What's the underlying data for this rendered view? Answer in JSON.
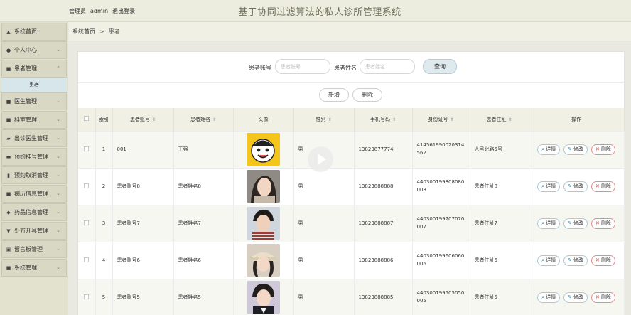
{
  "header": {
    "role": "管理员",
    "username": "admin",
    "logout": "退出登录",
    "title": "基于协同过滤算法的私人诊所管理系统"
  },
  "sidebar": {
    "items": [
      {
        "label": "系统首页",
        "icon": "home-icon",
        "glyph": "▲"
      },
      {
        "label": "个人中心",
        "icon": "user-icon",
        "glyph": "●",
        "chevron": "⌄"
      },
      {
        "label": "患者管理",
        "icon": "grid-icon",
        "glyph": "■",
        "chevron": "⌃"
      },
      {
        "label": "医生管理",
        "icon": "grid-icon",
        "glyph": "■",
        "chevron": "⌄"
      },
      {
        "label": "科室管理",
        "icon": "grid-icon",
        "glyph": "■",
        "chevron": "⌄"
      },
      {
        "label": "出诊医生管理",
        "icon": "briefcase-icon",
        "glyph": "▰",
        "chevron": "⌄"
      },
      {
        "label": "预约挂号管理",
        "icon": "monitor-icon",
        "glyph": "▬",
        "chevron": "⌄"
      },
      {
        "label": "预约取消管理",
        "icon": "chart-icon",
        "glyph": "▮",
        "chevron": "⌄"
      },
      {
        "label": "病历信息管理",
        "icon": "grid-icon",
        "glyph": "■",
        "chevron": "⌄"
      },
      {
        "label": "药品信息管理",
        "icon": "pill-icon",
        "glyph": "◆",
        "chevron": "⌄"
      },
      {
        "label": "处方开具管理",
        "icon": "shield-icon",
        "glyph": "▼",
        "chevron": "⌄"
      },
      {
        "label": "留言板管理",
        "icon": "message-icon",
        "glyph": "▣",
        "chevron": "⌄"
      },
      {
        "label": "系统管理",
        "icon": "grid-icon",
        "glyph": "■",
        "chevron": "⌄"
      }
    ],
    "sub_item": "患者"
  },
  "breadcrumb": {
    "home": "系统首页",
    "separator": ">",
    "current": "患者"
  },
  "search": {
    "account_label": "患者账号",
    "account_placeholder": "患者账号",
    "name_label": "患者姓名",
    "name_placeholder": "患者姓名",
    "query_button": "查询"
  },
  "actions": {
    "add": "新增",
    "delete": "删除"
  },
  "table": {
    "headers": [
      "索引",
      "患者账号",
      "患者姓名",
      "头像",
      "性别",
      "手机号码",
      "身份证号",
      "患者住址",
      "操作"
    ],
    "rows": [
      {
        "index": "1",
        "account": "001",
        "name": "王强",
        "gender": "男",
        "phone": "13823877774",
        "idcard": "414561990020314562",
        "address": "人民北路5号"
      },
      {
        "index": "2",
        "account": "患者账号8",
        "name": "患者姓名8",
        "gender": "男",
        "phone": "13823888888",
        "idcard": "440300199808080008",
        "address": "患者住址8"
      },
      {
        "index": "3",
        "account": "患者账号7",
        "name": "患者姓名7",
        "gender": "男",
        "phone": "13823888887",
        "idcard": "440300199707070007",
        "address": "患者住址7"
      },
      {
        "index": "4",
        "account": "患者账号6",
        "name": "患者姓名6",
        "gender": "男",
        "phone": "13823888886",
        "idcard": "440300199606060006",
        "address": "患者住址6"
      },
      {
        "index": "5",
        "account": "患者账号5",
        "name": "患者姓名5",
        "gender": "男",
        "phone": "13823888885",
        "idcard": "440300199505050005",
        "address": "患者住址5"
      }
    ],
    "op_detail": "详情",
    "op_edit": "修改",
    "op_delete": "删除"
  }
}
